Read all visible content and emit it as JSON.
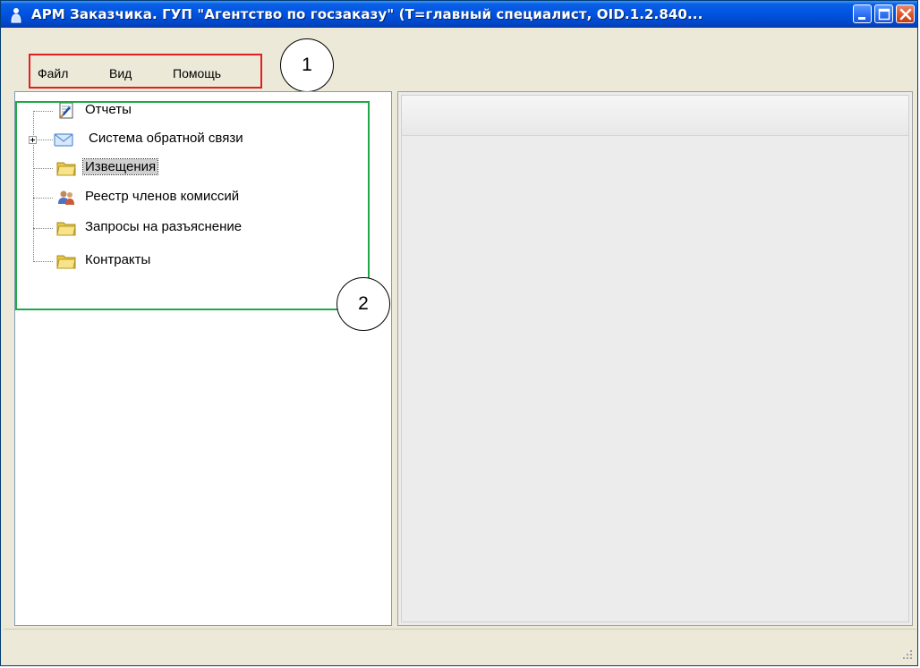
{
  "window": {
    "title": "АРМ Заказчика. ГУП \"Агентство по госзаказу\" (Т=главный специалист, OID.1.2.840...",
    "icon": "app-user-icon"
  },
  "menubar": {
    "items": [
      {
        "label": "Файл"
      },
      {
        "label": "Вид"
      },
      {
        "label": "Помощь"
      }
    ]
  },
  "callouts": [
    "1",
    "2"
  ],
  "tree": {
    "items": [
      {
        "label": "Отчеты",
        "icon": "report-icon",
        "selected": false,
        "expandable": false
      },
      {
        "label": "Система обратной связи",
        "icon": "envelope-icon",
        "selected": false,
        "expandable": true
      },
      {
        "label": "Извещения",
        "icon": "folder-icon",
        "selected": true,
        "expandable": false
      },
      {
        "label": "Реестр членов комиссий",
        "icon": "users-icon",
        "selected": false,
        "expandable": false
      },
      {
        "label": "Запросы на разъяснение",
        "icon": "folder-icon",
        "selected": false,
        "expandable": false
      },
      {
        "label": "Контракты",
        "icon": "folder-icon",
        "selected": false,
        "expandable": false
      }
    ]
  },
  "colors": {
    "titlebar": "#0054e3",
    "annotation_red": "#e02020",
    "annotation_green": "#1fa84a",
    "selection": "#d0d0d0"
  }
}
